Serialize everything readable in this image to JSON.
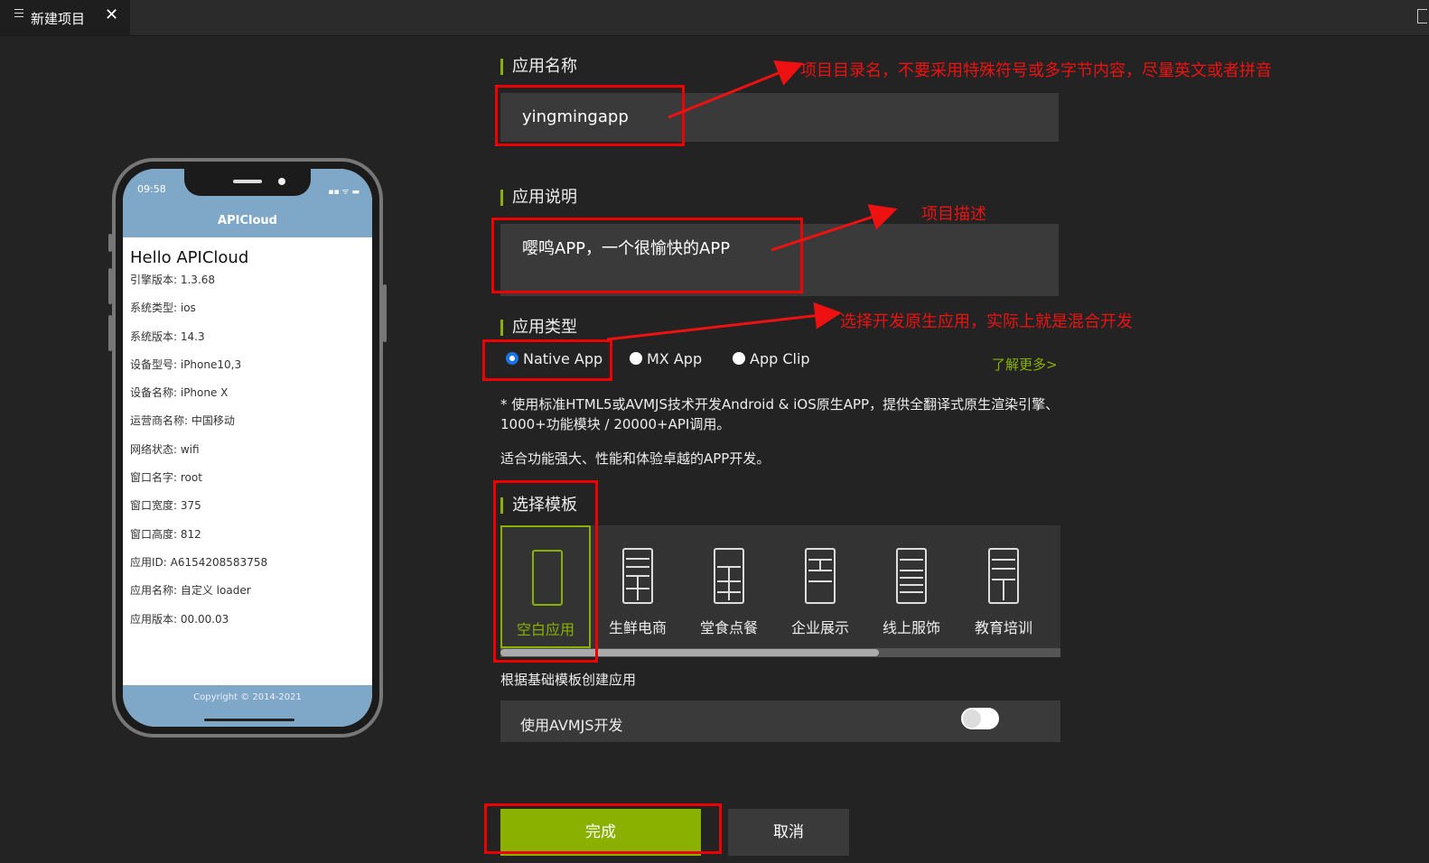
{
  "tab": {
    "title": "新建项目",
    "close": "✕"
  },
  "phone": {
    "time": "09:58",
    "status_icons": "▪▪ ᯤ ▬",
    "nav_title": "APICloud",
    "hello": "Hello APICloud",
    "info": [
      "引擎版本: 1.3.68",
      "系统类型: ios",
      "系统版本: 14.3",
      "设备型号: iPhone10,3",
      "设备名称: iPhone X",
      "运营商名称: 中国移动",
      "网络状态: wifi",
      "窗口名字: root",
      "窗口宽度: 375",
      "窗口高度: 812",
      "应用ID: A6154208583758",
      "应用名称: 自定义 loader",
      "应用版本: 00.00.03"
    ],
    "copyright": "Copyright © 2014-2021"
  },
  "form": {
    "app_name_label": "应用名称",
    "app_name_value": "yingmingapp",
    "app_desc_label": "应用说明",
    "app_desc_value": "嘤鸣APP，一个很愉快的APP",
    "app_type_label": "应用类型",
    "app_types": [
      "Native App",
      "MX App",
      "App Clip"
    ],
    "selected_type": "Native App",
    "learn_more": "了解更多>",
    "type_desc_1": "* 使用标准HTML5或AVMJS技术开发Android & iOS原生APP，提供全翻译式原生渲染引擎、1000+功能模块 / 20000+API调用。",
    "type_desc_2": "适合功能强大、性能和体验卓越的APP开发。",
    "template_label": "选择模板",
    "templates": [
      "空白应用",
      "生鲜电商",
      "堂食点餐",
      "企业展示",
      "线上服饰",
      "教育培训"
    ],
    "selected_template": "空白应用",
    "template_hint": "根据基础模板创建应用",
    "avm_label": "使用AVMJS开发",
    "avm_enabled": false,
    "ok": "完成",
    "cancel": "取消"
  },
  "annotations": {
    "name_note": "项目目录名，不要采用特殊符号或多字节内容，尽量英文或者拼音",
    "desc_note": "项目描述",
    "type_note": "选择开发原生应用，实际上就是混合开发"
  },
  "colors": {
    "accent": "#8ab000",
    "annotation": "#ee1111",
    "background": "#232323",
    "field": "#3a3a3a"
  }
}
